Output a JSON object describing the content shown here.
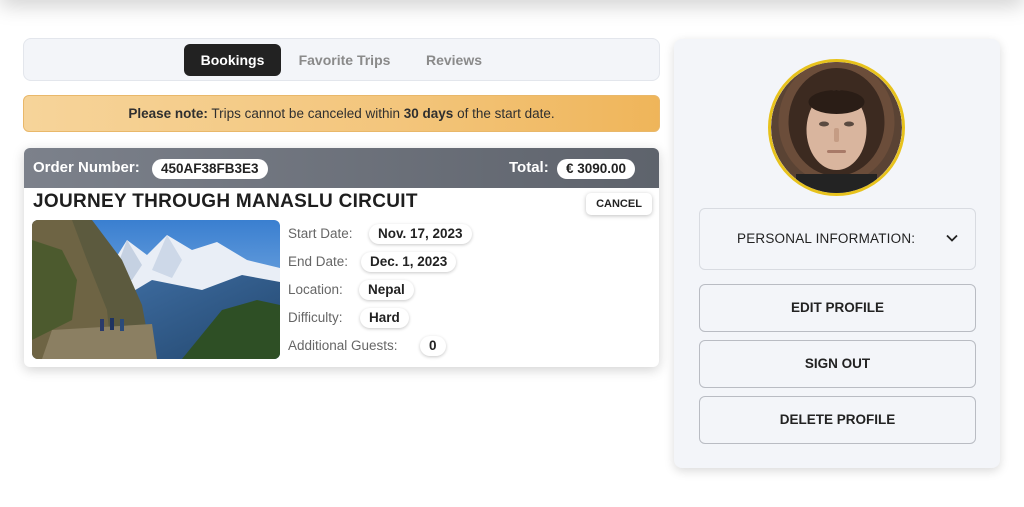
{
  "tabs": {
    "bookings": "Bookings",
    "favorite_trips": "Favorite Trips",
    "reviews": "Reviews",
    "active": "Bookings"
  },
  "notice": {
    "prefix": "Please note:",
    "text1": " Trips cannot be canceled within ",
    "highlight": "30 days",
    "text2": " of the start date."
  },
  "booking": {
    "order_label": "Order Number:",
    "order_number": "450AF38FB3E3",
    "total_label": "Total:",
    "total_value": "€ 3090.00",
    "title": "JOURNEY THROUGH MANASLU CIRCUIT",
    "cancel_label": "CANCEL",
    "details": {
      "start_date_label": "Start Date:",
      "start_date": "Nov. 17, 2023",
      "end_date_label": "End Date:",
      "end_date": "Dec. 1, 2023",
      "location_label": "Location:",
      "location": "Nepal",
      "difficulty_label": "Difficulty:",
      "difficulty": "Hard",
      "guests_label": "Additional Guests:",
      "guests": "0"
    }
  },
  "profile": {
    "accordion_label": "PERSONAL INFORMATION:",
    "edit_label": "EDIT PROFILE",
    "signout_label": "SIGN OUT",
    "delete_label": "DELETE PROFILE"
  },
  "colors": {
    "active_tab": "#222222",
    "notice_bg": "#f3c57b",
    "avatar_ring": "#e7c21c",
    "card_header": "#6a6f78"
  }
}
